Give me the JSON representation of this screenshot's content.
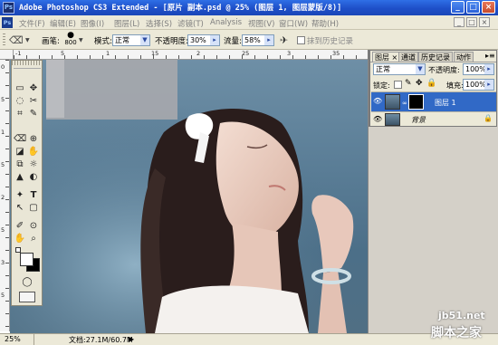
{
  "window": {
    "app_icon_text": "Ps",
    "title": "Adobe Photoshop CS3 Extended - [原片 副本.psd @ 25% (图层 1, 图层蒙版/8)]",
    "minimize_glyph": "_",
    "maximize_glyph": "□",
    "close_glyph": "×"
  },
  "menubar": {
    "app_mark": "Ps",
    "items": [
      "文件(F)",
      "编辑(E)",
      "图像(I)",
      "图层(L)",
      "选择(S)",
      "滤镜(T)",
      "Analysis",
      "视图(V)",
      "窗口(W)",
      "帮助(H)"
    ],
    "doc_controls": [
      "_",
      "□",
      "×"
    ]
  },
  "options_bar": {
    "brush_label": "画笔:",
    "brush_size": "800",
    "mode_label": "模式:",
    "mode_value": "正常",
    "opacity_label": "不透明度:",
    "opacity_value": "30%",
    "flow_label": "流量:",
    "flow_value": "58%",
    "history_label": "抹到历史记录"
  },
  "ruler": {
    "h_marks": [
      "-1",
      "5",
      "1",
      "15",
      "2",
      "25",
      "3",
      "35"
    ],
    "v_marks": [
      "0",
      "5",
      "1",
      "5",
      "2",
      "5",
      "3",
      "5"
    ]
  },
  "toolbox": {
    "tools": [
      [
        "▭",
        "✥"
      ],
      [
        "◌",
        "✂"
      ],
      [
        "⌗",
        "✎"
      ],
      [
        "⌫",
        "⊕"
      ],
      [
        "◪",
        "✋"
      ],
      [
        "⧉",
        "☼"
      ],
      [
        "▲",
        "◐"
      ],
      [
        "✦",
        "T"
      ],
      [
        "↖",
        "▢"
      ],
      [
        "✐",
        "⊙"
      ],
      [
        "✋",
        "⌕"
      ]
    ],
    "quickmask_glyphs": [
      "◯",
      "◍"
    ]
  },
  "panels": {
    "tabs": [
      "图层 ×",
      "通道",
      "历史记录",
      "动作"
    ],
    "blend_mode": "正常",
    "opacity_label": "不透明度:",
    "opacity_value": "100%",
    "lock_label": "锁定:",
    "fill_label": "填充:",
    "fill_value": "100%",
    "layers": [
      {
        "name": "图层 1",
        "selected": true
      },
      {
        "name": "背景",
        "selected": false
      }
    ],
    "eye_glyph": "👁"
  },
  "status": {
    "zoom": "25%",
    "doc_info": "文档:27.1M/60.7M",
    "arrow": "▶"
  },
  "watermark": {
    "site": "jb51.net",
    "brand": "脚本之家"
  },
  "colors": {
    "titlebar": "#1e4fc8",
    "selected_layer": "#3169c6",
    "canvas_bg": "#5a7d96"
  }
}
